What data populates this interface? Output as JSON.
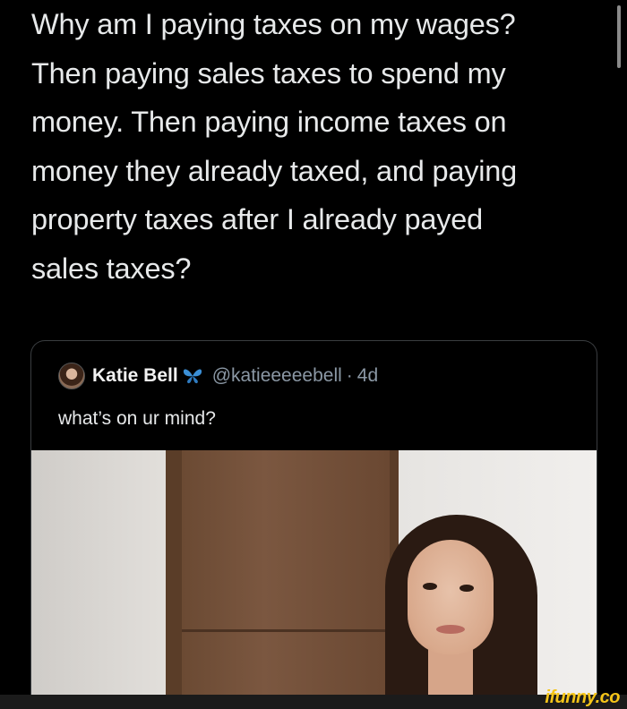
{
  "tweet": {
    "lines": [
      "Why am I paying taxes on my wages?",
      "Then paying sales taxes to spend my",
      "money. Then paying income taxes on",
      "money they already taxed, and paying",
      "property taxes after I already payed",
      "sales taxes?"
    ]
  },
  "quote": {
    "author_name": "Katie Bell",
    "verified_badge_icon": "butterfly-icon",
    "handle": "@katieeeeebell",
    "separator": "·",
    "time": "4d",
    "text": "what’s on ur mind?"
  },
  "watermark": "ifunny.co",
  "colors": {
    "background": "#000000",
    "text": "#e7e9ea",
    "secondary_text": "#8b98a5",
    "badge": "#3b8fd6",
    "watermark": "#f5c518"
  }
}
